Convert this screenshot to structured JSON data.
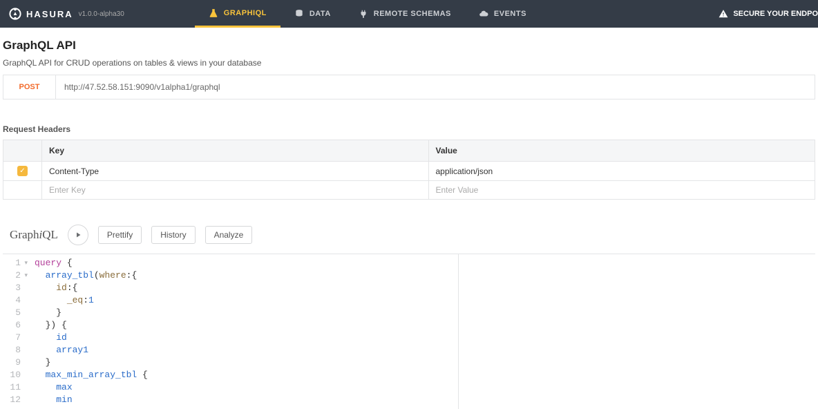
{
  "brand": {
    "name": "HASURA",
    "version": "v1.0.0-alpha30"
  },
  "nav": {
    "items": [
      {
        "label": "GRAPHIQL",
        "icon": "flask-icon",
        "active": true
      },
      {
        "label": "DATA",
        "icon": "stack-icon",
        "active": false
      },
      {
        "label": "REMOTE SCHEMAS",
        "icon": "plug-icon",
        "active": false
      },
      {
        "label": "EVENTS",
        "icon": "cloud-icon",
        "active": false
      }
    ],
    "secure": "SECURE YOUR ENDPO"
  },
  "page": {
    "title": "GraphQL API",
    "sub": "GraphQL API for CRUD operations on tables & views in your database"
  },
  "endpoint": {
    "method": "POST",
    "url": "http://47.52.58.151:9090/v1alpha1/graphql"
  },
  "headers": {
    "title": "Request Headers",
    "columns": {
      "key": "Key",
      "value": "Value"
    },
    "rows": [
      {
        "checked": true,
        "key": "Content-Type",
        "value": "application/json"
      }
    ],
    "placeholders": {
      "key": "Enter Key",
      "value": "Enter Value"
    }
  },
  "graphiql": {
    "title_plain": "Graph",
    "title_i": "i",
    "title_tail": "QL",
    "buttons": {
      "prettify": "Prettify",
      "history": "History",
      "analyze": "Analyze"
    }
  },
  "query": {
    "lines": [
      {
        "n": "1",
        "fold": true,
        "tokens": [
          [
            "kw",
            "query"
          ],
          [
            "",
            " {"
          ]
        ]
      },
      {
        "n": "2",
        "fold": true,
        "tokens": [
          [
            "",
            "  "
          ],
          [
            "fld",
            "array_tbl"
          ],
          [
            "",
            "("
          ],
          [
            "arg",
            "where"
          ],
          [
            "",
            ":{"
          ]
        ]
      },
      {
        "n": "3",
        "fold": false,
        "tokens": [
          [
            "",
            "    "
          ],
          [
            "arg",
            "id"
          ],
          [
            "",
            ":{"
          ]
        ]
      },
      {
        "n": "4",
        "fold": false,
        "tokens": [
          [
            "",
            "      "
          ],
          [
            "arg",
            "_eq"
          ],
          [
            "",
            ":"
          ],
          [
            "num",
            "1"
          ]
        ]
      },
      {
        "n": "5",
        "fold": false,
        "tokens": [
          [
            "",
            "    }"
          ]
        ]
      },
      {
        "n": "6",
        "fold": false,
        "tokens": [
          [
            "",
            "  }) {"
          ]
        ]
      },
      {
        "n": "7",
        "fold": false,
        "tokens": [
          [
            "",
            "    "
          ],
          [
            "fld",
            "id"
          ]
        ]
      },
      {
        "n": "8",
        "fold": false,
        "tokens": [
          [
            "",
            "    "
          ],
          [
            "fld",
            "array1"
          ]
        ]
      },
      {
        "n": "9",
        "fold": false,
        "tokens": [
          [
            "",
            "  }"
          ]
        ]
      },
      {
        "n": "10",
        "fold": false,
        "tokens": [
          [
            "",
            "  "
          ],
          [
            "fld",
            "max_min_array_tbl"
          ],
          [
            "",
            " {"
          ]
        ]
      },
      {
        "n": "11",
        "fold": false,
        "tokens": [
          [
            "",
            "    "
          ],
          [
            "fld",
            "max"
          ]
        ]
      },
      {
        "n": "12",
        "fold": false,
        "tokens": [
          [
            "",
            "    "
          ],
          [
            "fld",
            "min"
          ]
        ]
      }
    ]
  }
}
